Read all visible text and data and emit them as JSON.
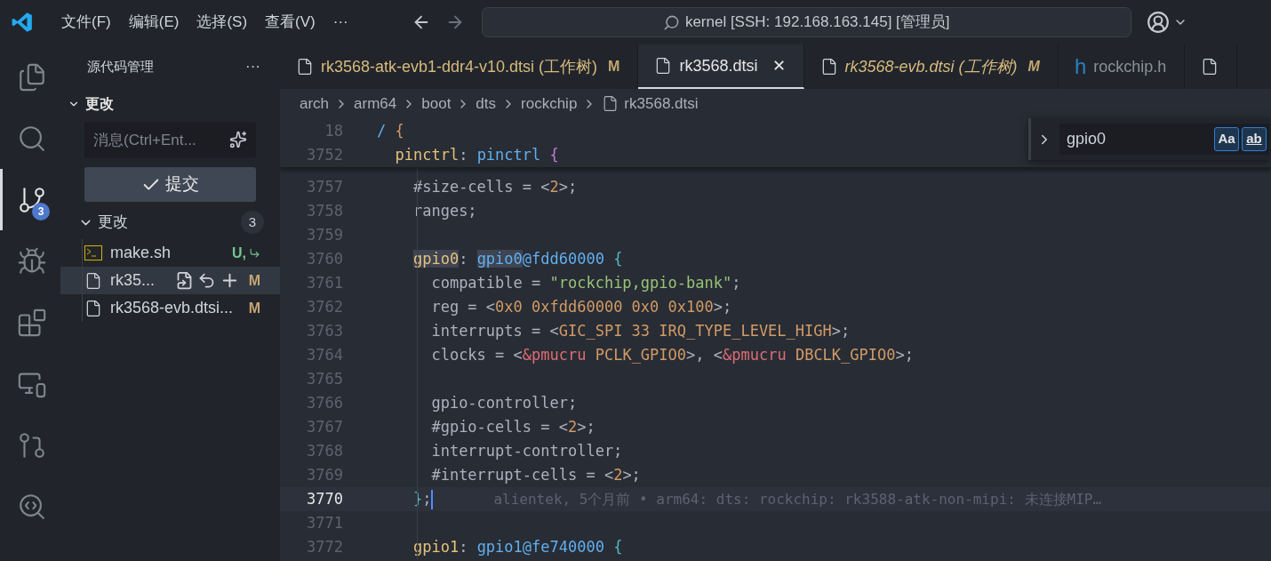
{
  "title_bar": {
    "menus": [
      "文件(F)",
      "编辑(E)",
      "选择(S)",
      "查看(V)",
      "···"
    ],
    "command_center": "kernel [SSH: 192.168.163.145] [管理员]"
  },
  "activity_bar": [
    {
      "selected": false
    },
    {
      "selected": false
    },
    {
      "selected": true,
      "badge": "3"
    },
    {
      "selected": false
    },
    {
      "selected": false
    },
    {
      "selected": false
    },
    {
      "selected": false
    },
    {
      "selected": false
    }
  ],
  "sidebar": {
    "title": "源代码管理",
    "more": "···",
    "section": {
      "label": "更改",
      "expanded": true
    },
    "message_field": {
      "placeholder": "消息(Ctrl+Ent..."
    },
    "commit_button": "提交",
    "group": {
      "label": "更改",
      "expanded": true,
      "count": "3"
    },
    "files": [
      {
        "kind": "untracked",
        "name": "make.sh",
        "status": "U,",
        "selected": false
      },
      {
        "kind": "modified",
        "name": "rk35...",
        "status": "M",
        "selected": true
      },
      {
        "kind": "modified",
        "name": "rk3568-evb.dtsi...",
        "status": "M",
        "selected": false
      }
    ]
  },
  "tabs": [
    {
      "label": "rk3568-atk-evb1-ddr4-v10.dtsi (工作树)",
      "status": "M",
      "selected": false,
      "preview": false
    },
    {
      "label": "rk3568.dtsi",
      "close": "✕",
      "selected": true,
      "preview": false
    },
    {
      "label": "rk3568-evb.dtsi (工作树)",
      "status": "M",
      "selected": false,
      "preview": true
    },
    {
      "icon_text": "h",
      "label": "rockchip.h",
      "selected": false,
      "preview": false
    },
    {
      "selected": false
    }
  ],
  "breadcrumbs": [
    "arch",
    "arm64",
    "boot",
    "dts",
    "rockchip",
    "rk3568.dtsi"
  ],
  "find_widget": {
    "value": "gpio0",
    "match_case": {
      "label": "Aa",
      "on": true
    },
    "whole_word": {
      "label": "ab",
      "on": true
    }
  },
  "sticky_lines": [
    {
      "number": "18",
      "tokens": [
        {
          "text": "/",
          "kind": "node"
        },
        {
          "text": " {",
          "kind": "brace1"
        }
      ]
    },
    {
      "number": "3752",
      "tokens": [
        {
          "text": "  pinctrl",
          "kind": "label"
        },
        {
          "text": ": ",
          "kind": "plain"
        },
        {
          "text": "pinctrl",
          "kind": "node"
        },
        {
          "text": " {",
          "kind": "brace2"
        }
      ]
    }
  ],
  "lines": [
    {
      "number": "3757",
      "current": false,
      "tokens": [
        {
          "text": "    #size-cells = <",
          "kind": "plain"
        },
        {
          "text": "2",
          "kind": "number"
        },
        {
          "text": ">;",
          "kind": "plain"
        }
      ]
    },
    {
      "number": "3758",
      "current": false,
      "tokens": [
        {
          "text": "    ranges;",
          "kind": "plain"
        }
      ]
    },
    {
      "number": "3759",
      "current": false
    },
    {
      "number": "3760",
      "current": false,
      "tokens": [
        {
          "text": "    gpio0",
          "kind": "label-match"
        },
        {
          "text": ": ",
          "kind": "plain"
        },
        {
          "text": "gpio0",
          "kind": "node-match"
        },
        {
          "text": "@fdd60000",
          "kind": "node"
        },
        {
          "text": " {",
          "kind": "brace3"
        }
      ]
    },
    {
      "number": "3761",
      "current": false,
      "tokens": [
        {
          "text": "      compatible = ",
          "kind": "plain"
        },
        {
          "text": "\"rockchip,gpio-bank\"",
          "kind": "string"
        },
        {
          "text": ";",
          "kind": "plain"
        }
      ]
    },
    {
      "number": "3762",
      "current": false,
      "tokens": [
        {
          "text": "      reg = <",
          "kind": "plain"
        },
        {
          "text": "0x0 0xfdd60000 0x0 0x100",
          "kind": "number"
        },
        {
          "text": ">;",
          "kind": "plain"
        }
      ]
    },
    {
      "number": "3763",
      "current": false,
      "tokens": [
        {
          "text": "      interrupts = <",
          "kind": "plain"
        },
        {
          "text": "GIC_SPI 33 IRQ_TYPE_LEVEL_HIGH",
          "kind": "number"
        },
        {
          "text": ">;",
          "kind": "plain"
        }
      ]
    },
    {
      "number": "3764",
      "current": false,
      "tokens": [
        {
          "text": "      clocks = <",
          "kind": "plain"
        },
        {
          "text": "&pmucru",
          "kind": "ref"
        },
        {
          "text": " PCLK_GPIO0",
          "kind": "number"
        },
        {
          "text": ">, <",
          "kind": "plain"
        },
        {
          "text": "&pmucru",
          "kind": "ref"
        },
        {
          "text": " DBCLK_GPIO0",
          "kind": "number"
        },
        {
          "text": ">;",
          "kind": "plain"
        }
      ]
    },
    {
      "number": "3765",
      "current": false
    },
    {
      "number": "3766",
      "current": false,
      "tokens": [
        {
          "text": "      gpio-controller;",
          "kind": "plain"
        }
      ]
    },
    {
      "number": "3767",
      "current": false,
      "tokens": [
        {
          "text": "      #gpio-cells = <",
          "kind": "plain"
        },
        {
          "text": "2",
          "kind": "number"
        },
        {
          "text": ">;",
          "kind": "plain"
        }
      ]
    },
    {
      "number": "3768",
      "current": false,
      "tokens": [
        {
          "text": "      interrupt-controller;",
          "kind": "plain"
        }
      ]
    },
    {
      "number": "3769",
      "current": false,
      "tokens": [
        {
          "text": "      #interrupt-cells = <",
          "kind": "plain"
        },
        {
          "text": "2",
          "kind": "number"
        },
        {
          "text": ">;",
          "kind": "plain"
        }
      ]
    },
    {
      "number": "3770",
      "current": true,
      "tokens": [
        {
          "text": "    }",
          "kind": "brace3"
        },
        {
          "text": ";",
          "kind": "plain"
        }
      ],
      "blame": "alientek, 5个月前 • arm64: dts: rockchip: rk3588-atk-non-mipi: 未连接MIP…"
    },
    {
      "number": "3771",
      "current": false
    },
    {
      "number": "3772",
      "current": false,
      "tokens": [
        {
          "text": "    gpio1",
          "kind": "label"
        },
        {
          "text": ": ",
          "kind": "plain"
        },
        {
          "text": "gpio1@fe740000",
          "kind": "node"
        },
        {
          "text": " {",
          "kind": "brace3"
        }
      ]
    }
  ]
}
